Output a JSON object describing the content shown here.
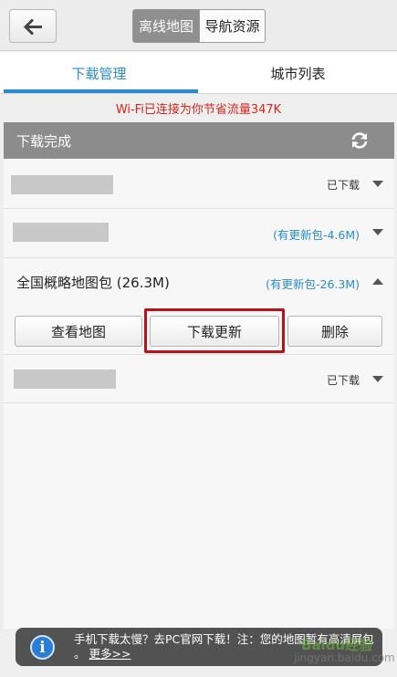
{
  "header": {
    "back_icon": "arrow-left-icon",
    "segments": [
      {
        "label": "离线地图",
        "active": true
      },
      {
        "label": "导航资源",
        "active": false
      }
    ]
  },
  "tabs": [
    {
      "label": "下载管理",
      "active": true
    },
    {
      "label": "城市列表",
      "active": false
    }
  ],
  "notice": "Wi-Fi已连接为你节省流量347K",
  "section": {
    "title": "下载完成",
    "refresh_icon": "refresh-icon"
  },
  "rows": [
    {
      "status": "已下载",
      "status_color": "#333333",
      "chevron": "down"
    },
    {
      "status": "(有更新包-4.6M)",
      "status_color": "#2a8cc9",
      "chevron": "down"
    },
    {
      "title": "全国概略地图包 (26.3M)",
      "status": "(有更新包-26.3M)",
      "status_color": "#2a8cc9",
      "chevron": "up",
      "actions": {
        "view": "查看地图",
        "update": "下载更新",
        "delete": "删除"
      }
    },
    {
      "status": "已下载",
      "status_color": "#333333",
      "chevron": "down"
    }
  ],
  "colors": {
    "accent": "#2a8cc9",
    "alert": "#d9261c",
    "highlight": "#b8121a"
  },
  "toast": {
    "icon": "info-icon",
    "text": "手机下载太慢？去PC官网下载！注：您的地图暂有高清屏包",
    "text_tail": "。",
    "more": "更多>>"
  },
  "watermark": {
    "line1": "Baidu经验",
    "line2": "jingyan.baidu.com"
  }
}
